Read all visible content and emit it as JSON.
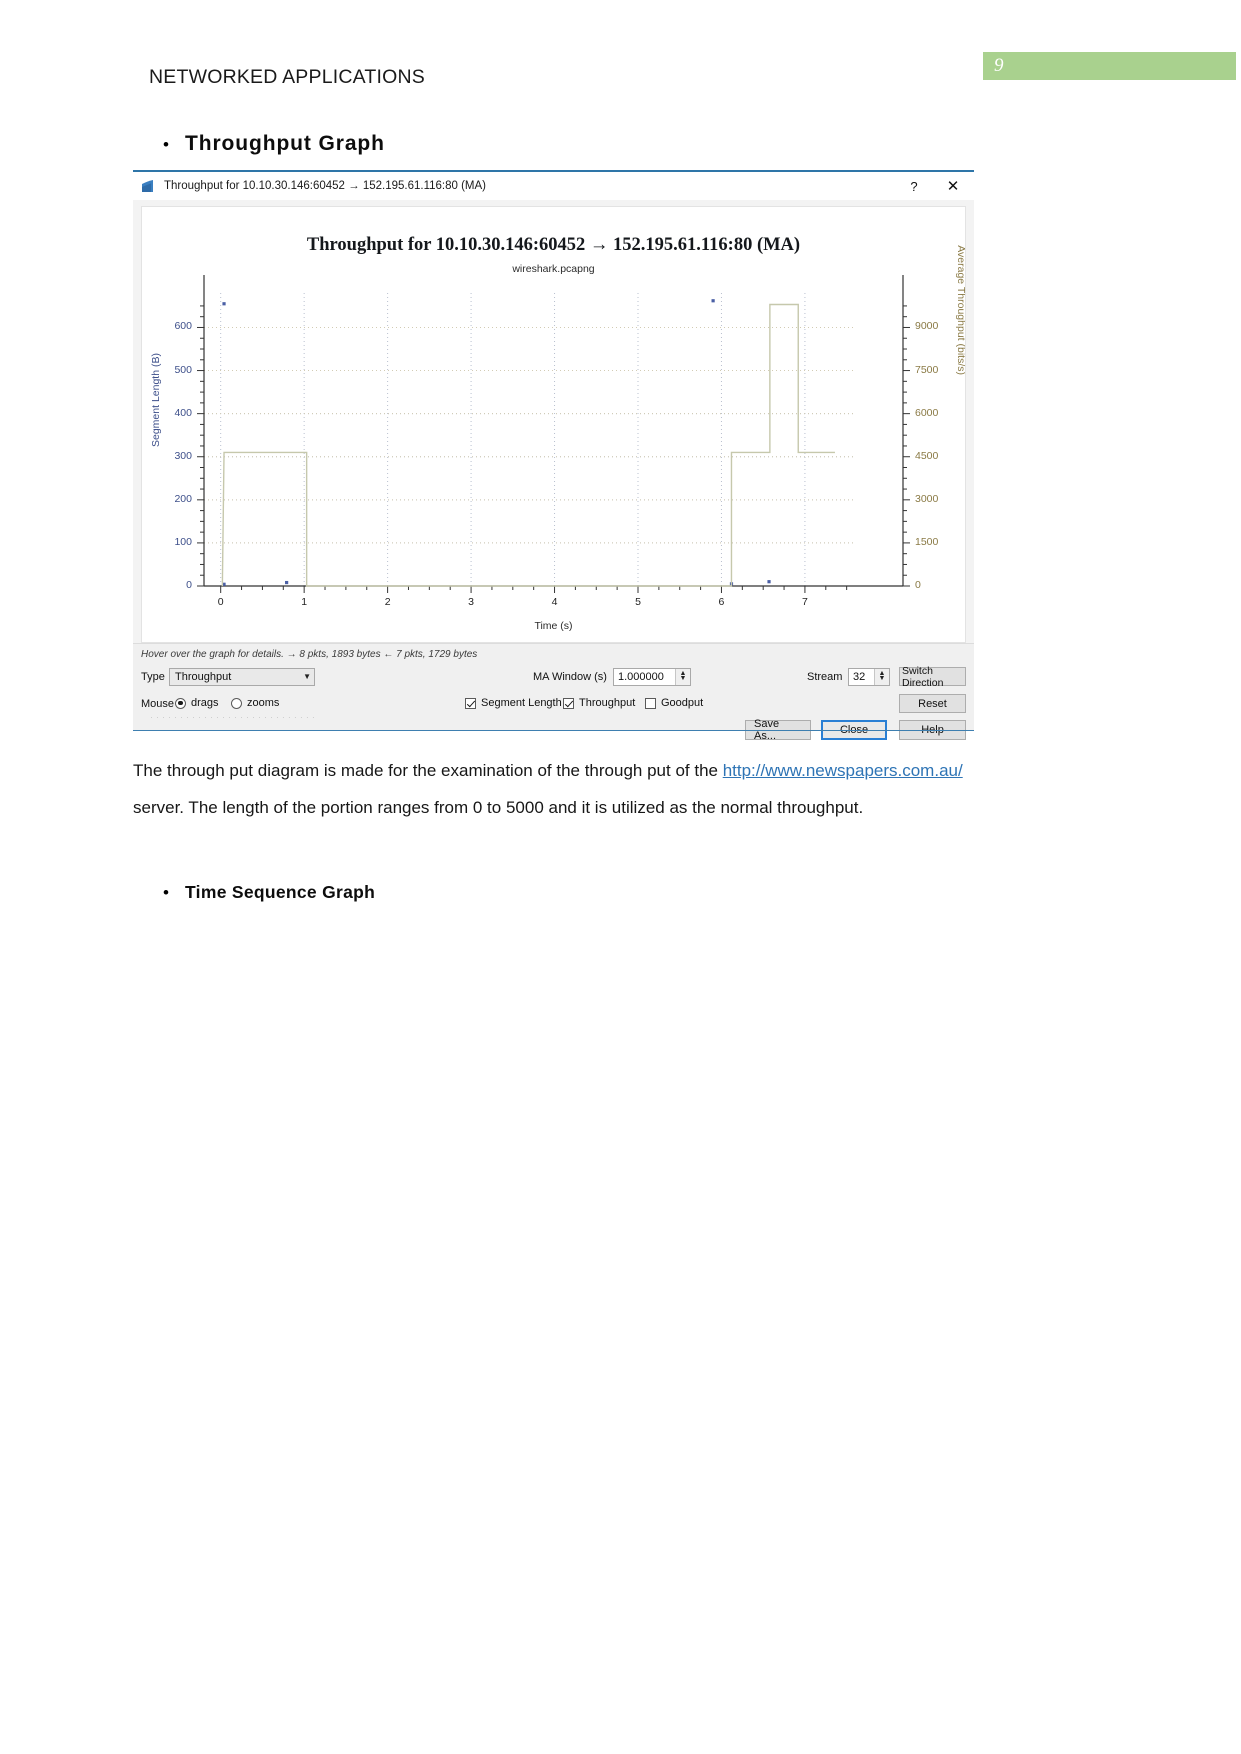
{
  "document": {
    "header_title": "NETWORKED APPLICATIONS",
    "page_number": "9",
    "bullet_marker": "•",
    "bullets": {
      "throughput_graph": "Throughput Graph",
      "time_sequence_graph": "Time Sequence Graph"
    },
    "paragraph": {
      "before_link": "The through put diagram is made for the examination of the through put of the ",
      "link_text": "http://www.newspapers.com.au/",
      "after_link": " server. The length of the portion ranges from 0 to 5000 and it is utilized as the normal throughput."
    },
    "smudge": "····························",
    "accent_green": "#a9d18e",
    "link_blue": "#2e74b5"
  },
  "window": {
    "title": "Throughput for 10.10.30.146:60452 → 152.195.61.116:80 (MA)",
    "help_button": "?",
    "close_button": "✕",
    "logo_name": "wireshark-logo"
  },
  "controls": {
    "hint": "Hover over the graph for details. → 8 pkts, 1893 bytes ← 7 pkts, 1729 bytes",
    "type_label": "Type",
    "type_value": "Throughput",
    "type_caret": "▼",
    "ma_window_label": "MA Window (s)",
    "ma_window_value": "1.000000",
    "stream_label": "Stream",
    "stream_value": "32",
    "switch_direction_label": "Switch Direction",
    "mouse_label": "Mouse",
    "mouse_drags_label": "drags",
    "mouse_zooms_label": "zooms",
    "mouse_mode": "drags",
    "checkbox_segment_length": {
      "label": "Segment Length",
      "checked": true
    },
    "checkbox_throughput": {
      "label": "Throughput",
      "checked": true
    },
    "checkbox_goodput": {
      "label": "Goodput",
      "checked": false
    },
    "reset_label": "Reset",
    "save_as_label": "Save As...",
    "close_label": "Close",
    "help_label": "Help",
    "spin_up": "▲",
    "spin_down": "▼"
  },
  "chart_data": {
    "type": "line",
    "title": "Throughput for 10.10.30.146:60452 → 152.195.61.116:80 (MA)",
    "subtitle": "wireshark.pcapng",
    "xlabel": "Time (s)",
    "ylabel": "Segment Length (B)",
    "y2label": "Average Throughput (bits/s)",
    "xlim": [
      -0.2,
      7.6
    ],
    "xticks": [
      0,
      1,
      2,
      3,
      4,
      5,
      6,
      7
    ],
    "xticklabels": [
      "0",
      "1",
      "2",
      "3",
      "4",
      "5",
      "6",
      "7"
    ],
    "ylim": [
      0,
      680
    ],
    "yticks": [
      0,
      100,
      200,
      300,
      400,
      500,
      600
    ],
    "yticklabels": [
      "0",
      "100",
      "200",
      "300",
      "400",
      "500",
      "600"
    ],
    "y2lim": [
      0,
      10200
    ],
    "y2ticks": [
      0,
      1500,
      3000,
      4500,
      6000,
      7500,
      9000
    ],
    "y2ticklabels": [
      "0",
      "1500",
      "3000",
      "4500",
      "6000",
      "7500",
      "9000"
    ],
    "grid": true,
    "legend_position": "none",
    "series": [
      {
        "name": "Segment Length",
        "color": "#4a5fa5",
        "style": "scatter",
        "points": [
          {
            "x": 0.04,
            "y": 655
          },
          {
            "x": 0.04,
            "y": 4
          },
          {
            "x": 0.79,
            "y": 8
          },
          {
            "x": 5.9,
            "y": 662
          },
          {
            "x": 6.57,
            "y": 10
          },
          {
            "x": 6.12,
            "y": 5
          }
        ]
      },
      {
        "name": "Average Throughput (MA)",
        "color": "#c6c8ac",
        "style": "step",
        "y_axis": "right",
        "points": [
          {
            "x": 0.02,
            "y": 0
          },
          {
            "x": 0.04,
            "y": 4650
          },
          {
            "x": 1.03,
            "y": 4650
          },
          {
            "x": 1.03,
            "y": 0
          },
          {
            "x": 6.12,
            "y": 0
          },
          {
            "x": 6.12,
            "y": 4650
          },
          {
            "x": 6.58,
            "y": 4650
          },
          {
            "x": 6.58,
            "y": 9800
          },
          {
            "x": 6.92,
            "y": 9800
          },
          {
            "x": 6.92,
            "y": 4650
          },
          {
            "x": 7.36,
            "y": 4650
          }
        ]
      }
    ]
  }
}
